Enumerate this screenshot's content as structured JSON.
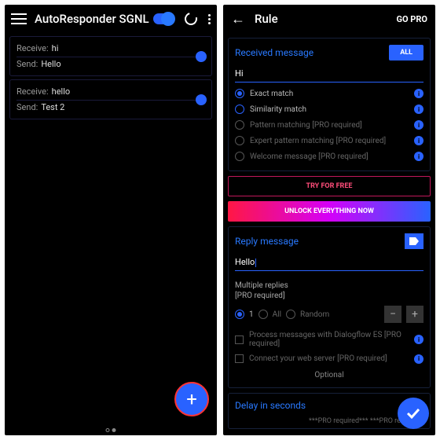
{
  "left": {
    "title": "AutoResponder SGNL",
    "rules": [
      {
        "receiveLabel": "Receive:",
        "receive": "hi",
        "sendLabel": "Send:",
        "send": "Hello"
      },
      {
        "receiveLabel": "Receive:",
        "receive": "hello",
        "sendLabel": "Send:",
        "send": "Test 2"
      }
    ]
  },
  "right": {
    "title": "Rule",
    "gopro": "GO PRO",
    "received": {
      "title": "Received message",
      "all": "ALL",
      "value": "Hi"
    },
    "match": {
      "exact": "Exact match",
      "similarity": "Similarity match",
      "pattern": "Pattern matching [PRO required]",
      "expert": "Expert pattern matching [PRO required]",
      "welcome": "Welcome message [PRO required]"
    },
    "tryFree": "TRY FOR FREE",
    "unlock": "UNLOCK EVERYTHING NOW",
    "reply": {
      "title": "Reply message",
      "value": "Hello"
    },
    "multi": {
      "title": "Multiple replies",
      "sub": "[PRO required]",
      "one": "1",
      "all": "All",
      "random": "Random"
    },
    "check1": "Process messages with Dialogflow ES [PRO required]",
    "check2": "Connect your web server [PRO required]",
    "optional": "Optional",
    "delay": "Delay in seconds",
    "proreq": "***PRO required***       ***PRO required"
  }
}
